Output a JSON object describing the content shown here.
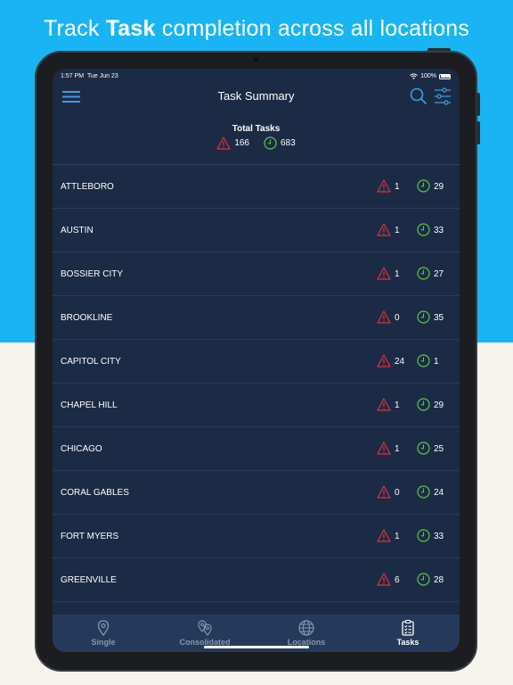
{
  "headline": {
    "prefix": "Track ",
    "bold": "Task",
    "suffix": " completion across all locations"
  },
  "status_bar": {
    "time": "1:57 PM",
    "date": "Tue Jun 23",
    "battery": "100%"
  },
  "nav": {
    "title": "Task Summary"
  },
  "summary": {
    "title": "Total Tasks",
    "overdue": "166",
    "pending": "683"
  },
  "locations": [
    {
      "name": "ATTLEBORO",
      "overdue": "1",
      "pending": "29"
    },
    {
      "name": "AUSTIN",
      "overdue": "1",
      "pending": "33"
    },
    {
      "name": "BOSSIER CITY",
      "overdue": "1",
      "pending": "27"
    },
    {
      "name": "BROOKLINE",
      "overdue": "0",
      "pending": "35"
    },
    {
      "name": "CAPITOL CITY",
      "overdue": "24",
      "pending": "1"
    },
    {
      "name": "CHAPEL HILL",
      "overdue": "1",
      "pending": "29"
    },
    {
      "name": "CHICAGO",
      "overdue": "1",
      "pending": "25"
    },
    {
      "name": "CORAL GABLES",
      "overdue": "0",
      "pending": "24"
    },
    {
      "name": "FORT MYERS",
      "overdue": "1",
      "pending": "33"
    },
    {
      "name": "GREENVILLE",
      "overdue": "6",
      "pending": "28"
    }
  ],
  "tabs": [
    {
      "label": "Single",
      "icon": "map-pin-icon"
    },
    {
      "label": "Consolidated",
      "icon": "multi-pin-icon"
    },
    {
      "label": "Locations",
      "icon": "globe-icon"
    },
    {
      "label": "Tasks",
      "icon": "clipboard-icon",
      "active": true
    }
  ],
  "colors": {
    "background_top": "#18b4f4",
    "background_bottom": "#f7f4ee",
    "screen": "#1c2b45",
    "tabbar": "#253a5b",
    "accent_blue": "#3a9ee6",
    "warning_red": "#e0303a",
    "pending_green": "#5fc548"
  }
}
